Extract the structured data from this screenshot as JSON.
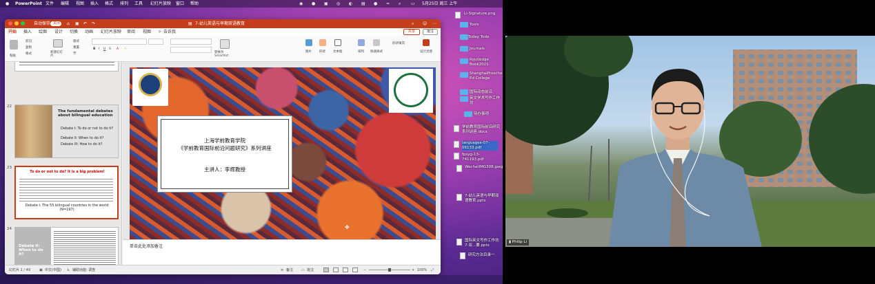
{
  "menubar": {
    "apple": "",
    "app": "PowerPoint",
    "items": [
      "文件",
      "编辑",
      "视图",
      "插入",
      "格式",
      "排列",
      "工具",
      "幻灯片放映",
      "窗口",
      "帮助"
    ],
    "datetime": "5月25日 周三 上午"
  },
  "window": {
    "autosave": "自动保存",
    "autosave_state": "关闭",
    "doc_title": "7-幼儿英语与早期双语教育",
    "share": "共享",
    "comment": "批注"
  },
  "ribbon_tabs": [
    "开始",
    "插入",
    "绘图",
    "设计",
    "切换",
    "动画",
    "幻灯片放映",
    "审阅",
    "视图",
    "告诉我"
  ],
  "ribbon": {
    "paste": "粘贴",
    "cut": "剪切",
    "copy": "复制",
    "format": "格式",
    "new_slide": "新建幻灯片",
    "layout": "版式",
    "reset": "重置",
    "section": "节",
    "convert_smartart": "转换为SmartArt",
    "picture": "图片",
    "shape": "形状",
    "textbox": "文本框",
    "arrange": "排列",
    "quick_styles": "快速样式",
    "shape_fill": "形状填充",
    "designer": "设计灵感"
  },
  "thumbnails": [
    {
      "num": "22",
      "title": "The fundamental debates about bilingual education",
      "lines": [
        "Debate I: To do or not to do it?",
        "Debate II: When to do it?",
        "Debate III: How to do it?"
      ]
    },
    {
      "num": "23",
      "title": "To do or not to do? It is a big problem!",
      "caption": "Debate I: The 55 bilingual countries in the world (N=197)"
    },
    {
      "num": "24",
      "title": "Debate II: When to do it?"
    }
  ],
  "slide": {
    "org_line": "上海学前教育学院",
    "series_line": "《学前教育国际前沿问题研究》系列讲座",
    "speaker": "主讲人：李辉教授"
  },
  "notes_placeholder": "单击此处添加备注",
  "status": {
    "slide_counter": "幻灯片 1 / 49",
    "language": "中文(中国)",
    "accessibility": "辅助功能: 调查",
    "notes": "备注",
    "comments": "批注",
    "zoom": "100%"
  },
  "desktop": [
    {
      "label": "Li-Signature.png",
      "kind": "doc"
    },
    {
      "label": "Tools",
      "kind": "folder"
    },
    {
      "label": "Today Todo",
      "kind": "folder"
    },
    {
      "label": "Journals",
      "kind": "folder"
    },
    {
      "label": "Routledge Book2021",
      "kind": "folder"
    },
    {
      "label": "ShanghaiPreschool Ed College",
      "kind": "folder"
    },
    {
      "label": "国际动态前沿",
      "kind": "folder"
    },
    {
      "label": "英文学术写作工作坊",
      "kind": "folder"
    },
    {
      "label": "待办事项",
      "kind": "folder"
    },
    {
      "label": "学前教育国际前沿研究系列讲座.docx",
      "kind": "doc"
    },
    {
      "label": "languages-07-06133.pdf",
      "kind": "doc"
    },
    {
      "label": "fpsyg-13-741193.pdf",
      "kind": "doc"
    },
    {
      "label": "WechatIMG308.jpeg",
      "kind": "doc"
    },
    {
      "label": "7-幼儿英语与早期双语教育.pptx",
      "kind": "doc"
    },
    {
      "label": "国际英文写作工作坊7-双...要.pptx",
      "kind": "doc"
    },
    {
      "label": "研究方法目录一",
      "kind": "doc"
    }
  ],
  "video": {
    "participant_name": "Philip Li"
  }
}
